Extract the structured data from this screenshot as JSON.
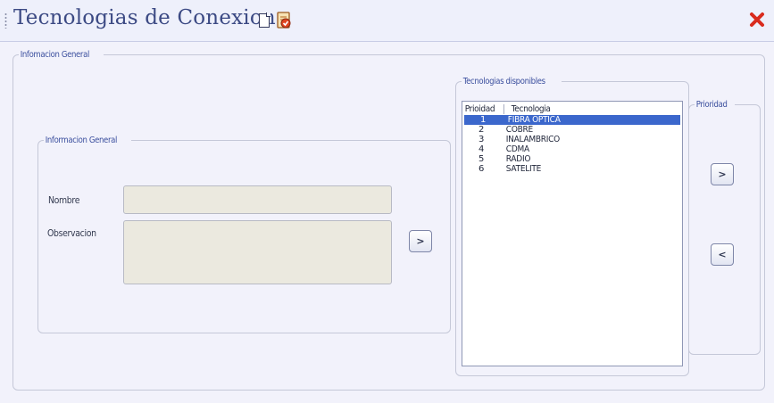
{
  "window": {
    "title": "Tecnologias de Conexion"
  },
  "outer_group": {
    "legend": "Infomacion General"
  },
  "info_group": {
    "legend": "Informacion General",
    "nombre_label": "Nombre",
    "nombre_value": "",
    "observacion_label": "Observacion",
    "observacion_value": ""
  },
  "buttons": {
    "add_label": ">",
    "prio_up_label": ">",
    "prio_down_label": "<"
  },
  "tech_group": {
    "legend": "Tecnologias disponibles",
    "columns": [
      "Prioidad",
      "Tecnologia"
    ],
    "rows": [
      {
        "priority": "1",
        "technology": "FIBRA OPTICA",
        "selected": true
      },
      {
        "priority": "2",
        "technology": "COBRE",
        "selected": false
      },
      {
        "priority": "3",
        "technology": "INALAMBRICO",
        "selected": false
      },
      {
        "priority": "4",
        "technology": "CDMA",
        "selected": false
      },
      {
        "priority": "5",
        "technology": "RADIO",
        "selected": false
      },
      {
        "priority": "6",
        "technology": "SATELITE",
        "selected": false
      }
    ]
  },
  "priority_group": {
    "legend": "Prioridad"
  },
  "colors": {
    "title": "#3c4a84",
    "legend": "#3b4f9e",
    "selection": "#3b67cc",
    "close": "#d92b1e",
    "background": "#f2f2fb"
  },
  "icons": {
    "title_grip": "grip-icon",
    "new_document": "new-document-icon",
    "edit_document": "edit-document-icon",
    "close": "close-icon"
  }
}
